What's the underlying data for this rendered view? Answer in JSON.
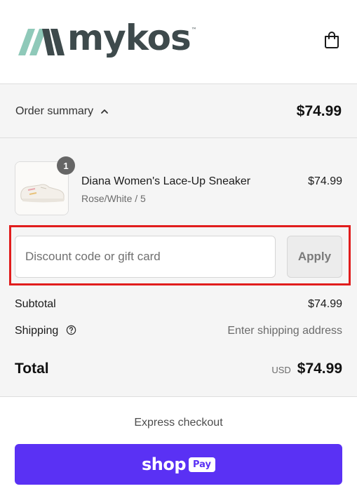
{
  "brand": {
    "name": "mykos",
    "tm": "™",
    "mark_color_1": "#8fc9b9",
    "mark_color_2": "#3e4a4c"
  },
  "header": {
    "cart_icon": "shopping-bag-icon"
  },
  "summary": {
    "toggle_label": "Order summary",
    "toggle_icon": "chevron-up-icon",
    "toggle_total": "$74.99"
  },
  "product": {
    "quantity": "1",
    "name": "Diana Women's Lace-Up Sneaker",
    "variant": "Rose/White / 5",
    "price": "$74.99"
  },
  "discount": {
    "placeholder": "Discount code or gift card",
    "value": "",
    "apply_label": "Apply",
    "highlight_color": "#e11d1d"
  },
  "totals": {
    "subtotal_label": "Subtotal",
    "subtotal_value": "$74.99",
    "shipping_label": "Shipping",
    "shipping_value": "Enter shipping address",
    "total_label": "Total",
    "currency": "USD",
    "total_value": "$74.99"
  },
  "express": {
    "label": "Express checkout",
    "shop_word": "shop",
    "pay_word": "Pay",
    "button_color": "#5a31f4"
  }
}
